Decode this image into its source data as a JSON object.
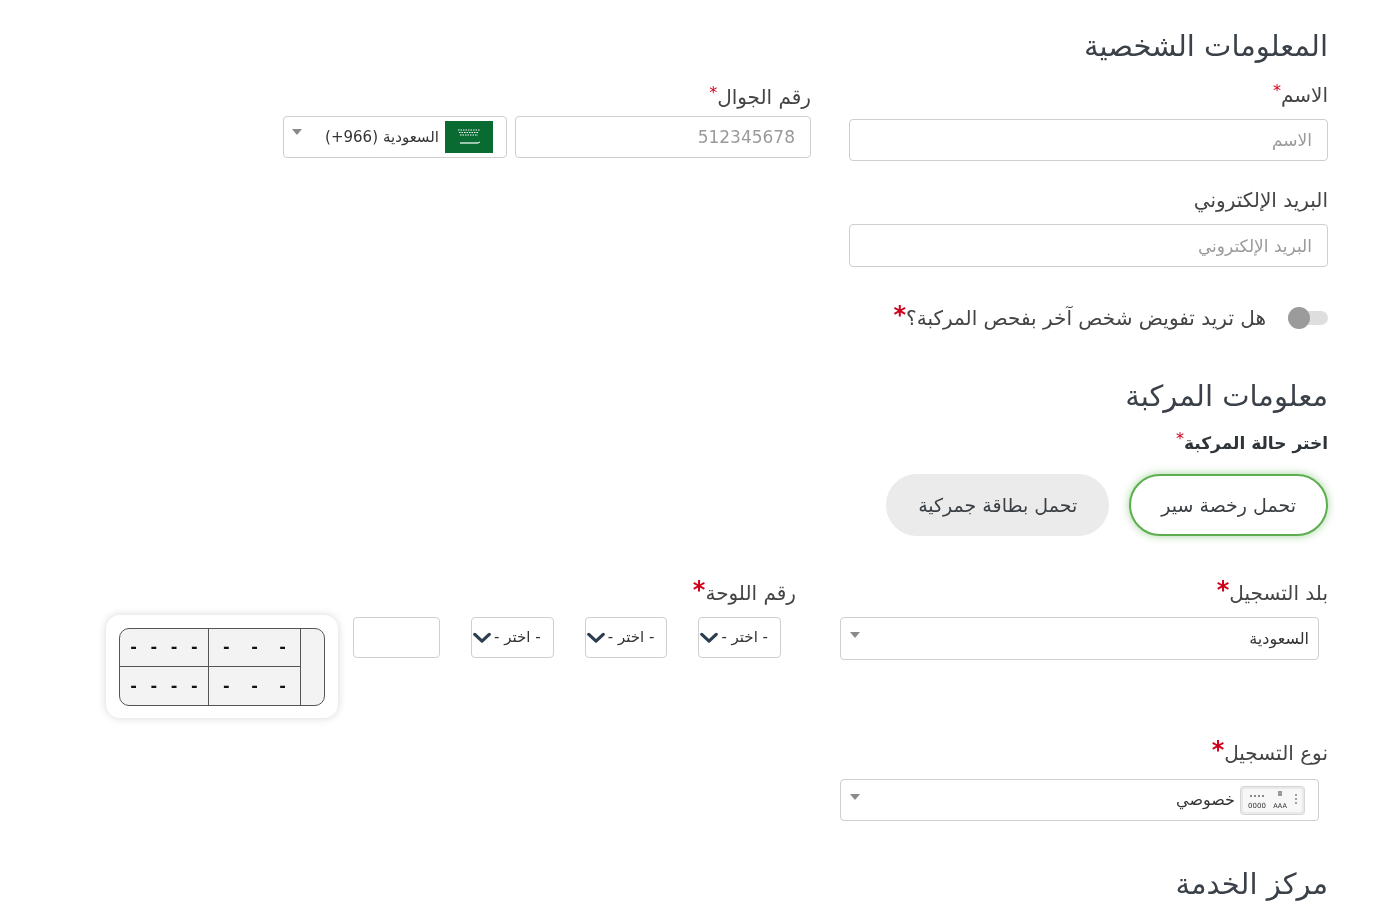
{
  "personal_info": {
    "title": "المعلومات الشخصية",
    "name": {
      "label": "الاسم",
      "required_mark": "*",
      "placeholder": "الاسم"
    },
    "mobile": {
      "label": "رقم الجوال",
      "required_mark": "*",
      "placeholder": "512345678",
      "country": {
        "name": "السعودية",
        "dial_code": "(+966)"
      }
    },
    "email": {
      "label": "البريد الإلكتروني",
      "placeholder": "البريد الإلكتروني"
    },
    "delegate": {
      "label": "هل تريد تفويض شخص آخر بفحص المركبة؟",
      "required_mark": "*",
      "on": false
    }
  },
  "vehicle_info": {
    "title": "معلومات المركبة",
    "status": {
      "label": "اختر حالة المركبة",
      "required_mark": "*",
      "options": [
        {
          "label": "تحمل رخصة سير",
          "selected": true
        },
        {
          "label": "تحمل بطاقة جمركية",
          "selected": false
        }
      ]
    },
    "registration_country": {
      "label": "بلد التسجيل",
      "required_mark": "*",
      "value": "السعودية"
    },
    "plate_number": {
      "label": "رقم اللوحة",
      "required_mark": "*",
      "letter_selects": [
        {
          "value": "- اختر -"
        },
        {
          "value": "- اختر -"
        },
        {
          "value": "- اختر -"
        }
      ],
      "preview": {
        "rows": [
          [
            "- - -",
            "- - - -"
          ],
          [
            "- - -",
            "- - - -"
          ]
        ]
      }
    },
    "registration_type": {
      "label": "نوع التسجيل",
      "required_mark": "*",
      "value": "خصوصي",
      "icon_letters": "AAA",
      "icon_digits": "0000"
    }
  },
  "service_center": {
    "title": "مركز الخدمة"
  }
}
